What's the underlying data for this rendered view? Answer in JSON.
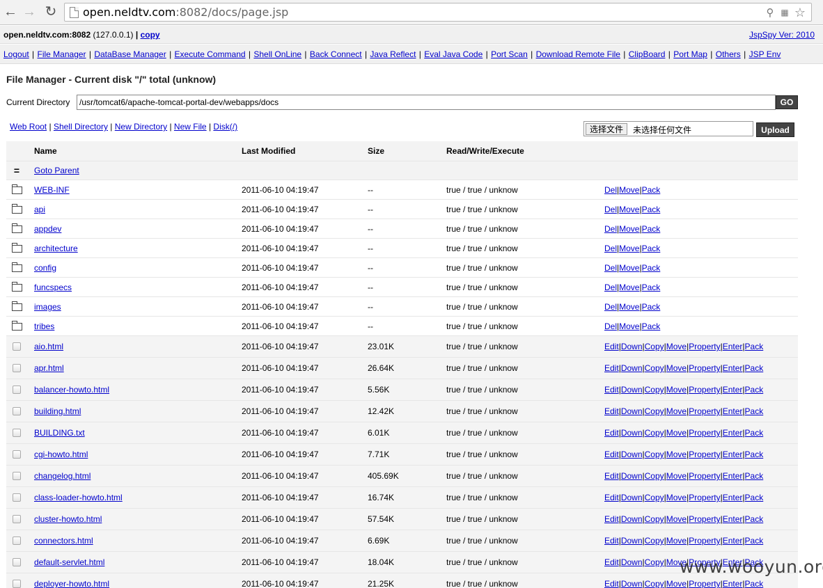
{
  "browser": {
    "url_host": "open.neldtv.com",
    "url_rest": ":8082/docs/page.jsp"
  },
  "header": {
    "host": "open.neldtv.com:8082",
    "ip": "(127.0.0.1)",
    "sep": "|",
    "copy_label": "copy",
    "version": "JspSpy Ver: 2010"
  },
  "menu": [
    "Logout",
    "File Manager",
    "DataBase Manager",
    "Execute Command",
    "Shell OnLine",
    "Back Connect",
    "Java Reflect",
    "Eval Java Code",
    "Port Scan",
    "Download Remote File",
    "ClipBoard",
    "Port Map",
    "Others",
    "JSP Env"
  ],
  "file_manager": {
    "title": "File Manager - Current disk \"/\" total (unknow)",
    "current_dir_label": "Current Directory",
    "current_dir_value": "/usr/tomcat6/apache-tomcat-portal-dev/webapps/docs",
    "go_label": "GO",
    "quick_links": [
      "Web Root",
      "Shell Directory",
      "New Directory",
      "New File",
      "Disk(/)"
    ],
    "choose_file_label": "选择文件",
    "no_file_label": "未选择任何文件",
    "upload_label": "Upload"
  },
  "table": {
    "headers": {
      "name": "Name",
      "modified": "Last Modified",
      "size": "Size",
      "rwx": "Read/Write/Execute"
    },
    "parent_icon": "=",
    "parent_label": "Goto Parent",
    "dir_actions": [
      "Del",
      "Move",
      "Pack"
    ],
    "file_actions": [
      "Edit",
      "Down",
      "Copy",
      "Move",
      "Property",
      "Enter",
      "Pack"
    ],
    "dirs": [
      {
        "name": "WEB-INF",
        "modified": "2011-06-10 04:19:47",
        "size": "--",
        "rwx": "true / true / unknow"
      },
      {
        "name": "api",
        "modified": "2011-06-10 04:19:47",
        "size": "--",
        "rwx": "true / true / unknow"
      },
      {
        "name": "appdev",
        "modified": "2011-06-10 04:19:47",
        "size": "--",
        "rwx": "true / true / unknow"
      },
      {
        "name": "architecture",
        "modified": "2011-06-10 04:19:47",
        "size": "--",
        "rwx": "true / true / unknow"
      },
      {
        "name": "config",
        "modified": "2011-06-10 04:19:47",
        "size": "--",
        "rwx": "true / true / unknow"
      },
      {
        "name": "funcspecs",
        "modified": "2011-06-10 04:19:47",
        "size": "--",
        "rwx": "true / true / unknow"
      },
      {
        "name": "images",
        "modified": "2011-06-10 04:19:47",
        "size": "--",
        "rwx": "true / true / unknow"
      },
      {
        "name": "tribes",
        "modified": "2011-06-10 04:19:47",
        "size": "--",
        "rwx": "true / true / unknow"
      }
    ],
    "files": [
      {
        "name": "aio.html",
        "modified": "2011-06-10 04:19:47",
        "size": "23.01K",
        "rwx": "true / true / unknow"
      },
      {
        "name": "apr.html",
        "modified": "2011-06-10 04:19:47",
        "size": "26.64K",
        "rwx": "true / true / unknow"
      },
      {
        "name": "balancer-howto.html",
        "modified": "2011-06-10 04:19:47",
        "size": "5.56K",
        "rwx": "true / true / unknow"
      },
      {
        "name": "building.html",
        "modified": "2011-06-10 04:19:47",
        "size": "12.42K",
        "rwx": "true / true / unknow"
      },
      {
        "name": "BUILDING.txt",
        "modified": "2011-06-10 04:19:47",
        "size": "6.01K",
        "rwx": "true / true / unknow"
      },
      {
        "name": "cgi-howto.html",
        "modified": "2011-06-10 04:19:47",
        "size": "7.71K",
        "rwx": "true / true / unknow"
      },
      {
        "name": "changelog.html",
        "modified": "2011-06-10 04:19:47",
        "size": "405.69K",
        "rwx": "true / true / unknow"
      },
      {
        "name": "class-loader-howto.html",
        "modified": "2011-06-10 04:19:47",
        "size": "16.74K",
        "rwx": "true / true / unknow"
      },
      {
        "name": "cluster-howto.html",
        "modified": "2011-06-10 04:19:47",
        "size": "57.54K",
        "rwx": "true / true / unknow"
      },
      {
        "name": "connectors.html",
        "modified": "2011-06-10 04:19:47",
        "size": "6.69K",
        "rwx": "true / true / unknow"
      },
      {
        "name": "default-servlet.html",
        "modified": "2011-06-10 04:19:47",
        "size": "18.04K",
        "rwx": "true / true / unknow"
      },
      {
        "name": "deployer-howto.html",
        "modified": "2011-06-10 04:19:47",
        "size": "21.25K",
        "rwx": "true / true / unknow"
      }
    ]
  },
  "watermark": "www.wooyun.org"
}
